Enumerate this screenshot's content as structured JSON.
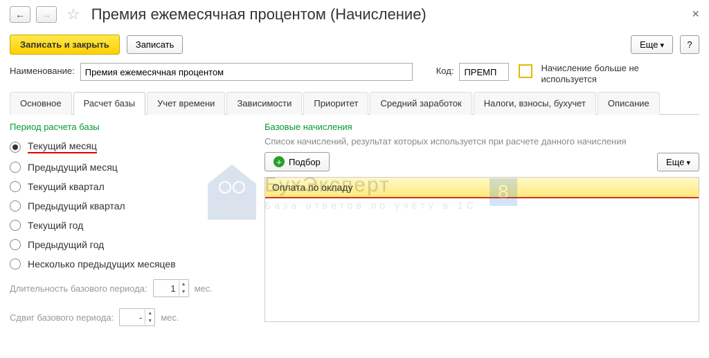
{
  "window": {
    "title": "Премия ежемесячная процентом (Начисление)"
  },
  "toolbar": {
    "save_close": "Записать и закрыть",
    "save": "Записать",
    "more": "Еще",
    "help": "?"
  },
  "form": {
    "name_label": "Наименование:",
    "name_value": "Премия ежемесячная процентом",
    "code_label": "Код:",
    "code_value": "ПРЕМП",
    "not_used_label": "Начисление больше не используется"
  },
  "tabs": [
    "Основное",
    "Расчет базы",
    "Учет времени",
    "Зависимости",
    "Приоритет",
    "Средний заработок",
    "Налоги, взносы, бухучет",
    "Описание"
  ],
  "period": {
    "title": "Период расчета базы",
    "options": [
      "Текущий месяц",
      "Предыдущий месяц",
      "Текущий квартал",
      "Предыдущий квартал",
      "Текущий год",
      "Предыдущий год",
      "Несколько предыдущих месяцев"
    ],
    "duration_label": "Длительность базового периода:",
    "duration_value": "1",
    "dur_unit": "мес.",
    "shift_label": "Сдвиг базового периода:",
    "shift_value": "-",
    "shift_unit": "мес."
  },
  "base": {
    "title": "Базовые начисления",
    "hint": "Список начислений, результат которых используется при расчете данного начисления",
    "pick": "Подбор",
    "more": "Еще",
    "items": [
      "Оплата по окладу"
    ]
  },
  "watermark": {
    "line1": "БухЭксперт",
    "line2": "База ответов по учёту в 1С",
    "badge": "8"
  }
}
